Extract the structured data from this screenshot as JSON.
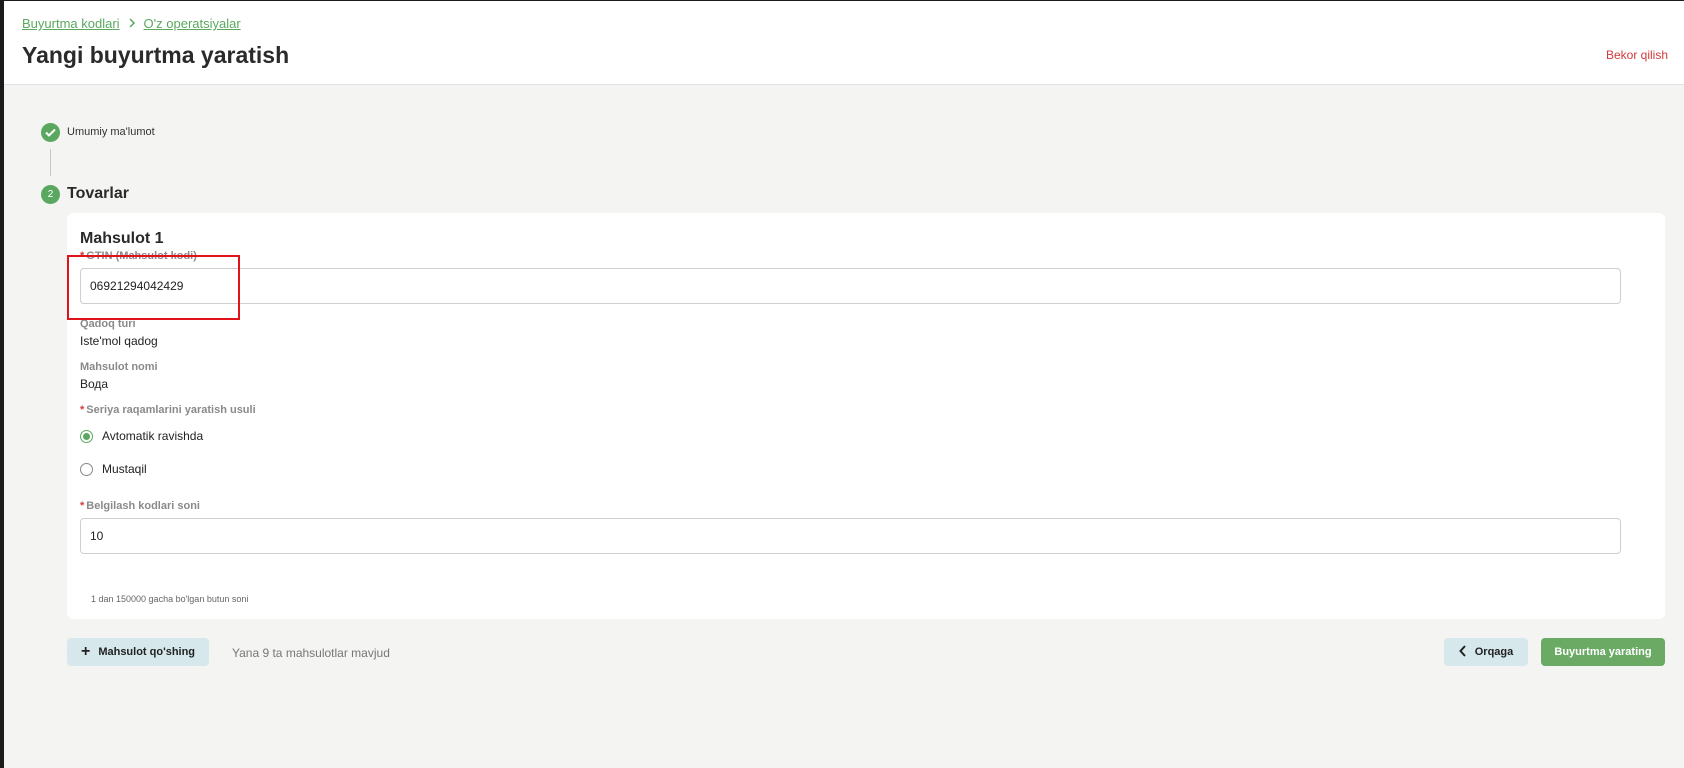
{
  "breadcrumb": {
    "items": [
      "Buyurtma kodlari",
      "O'z operatsiyalar"
    ]
  },
  "header": {
    "title": "Yangi buyurtma yaratish",
    "cancel_label": "Bekor qilish"
  },
  "steps": {
    "step1_label": "Umumiy ma'lumot",
    "step2_number": "2",
    "step2_label": "Tovarlar"
  },
  "product": {
    "title": "Mahsulot 1",
    "gtin_label": "GTIN (Mahsulot kodi)",
    "gtin_value": "06921294042429",
    "package_label": "Qadoq turi",
    "package_value": "Iste'mol qadog",
    "name_label": "Mahsulot nomi",
    "name_value": "Вода",
    "serial_method_label": "Seriya raqamlarini yaratish usuli",
    "serial_options": [
      "Avtomatik ravishda",
      "Mustaqil"
    ],
    "serial_selected": "Avtomatik ravishda",
    "codes_count_label": "Belgilash kodlari soni",
    "codes_count_value": "10",
    "codes_count_hint": "1 dan 150000 gacha bo'lgan butun soni"
  },
  "footer": {
    "add_product_label": "Mahsulot qo'shing",
    "remaining_text": "Yana 9 ta mahsulotlar mavjud",
    "back_label": "Orqaga",
    "create_label": "Buyurtma yarating"
  },
  "colors": {
    "accent_green": "#5aa85f",
    "danger_red": "#d23b3b",
    "button_light": "#d6e8ec",
    "highlight_red": "#e0131b"
  }
}
